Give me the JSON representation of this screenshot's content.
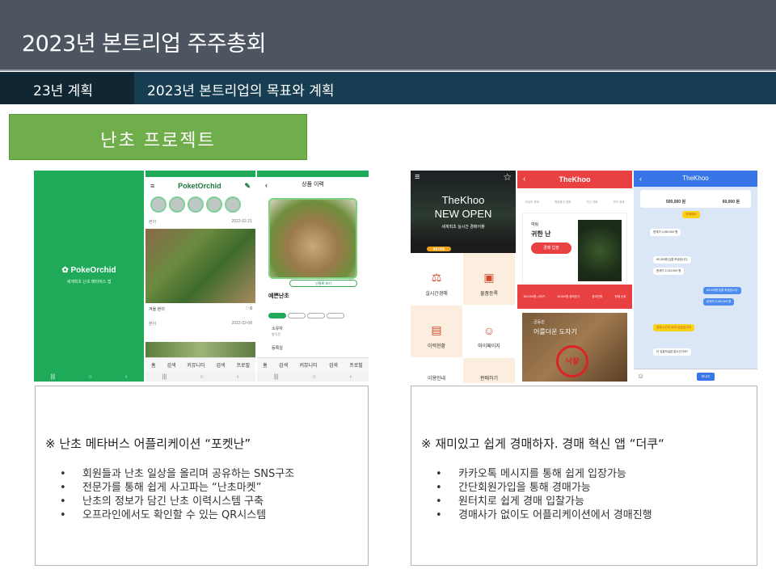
{
  "header": {
    "title": "2023년 본트리업 주주총회"
  },
  "subbar": {
    "left_label": "23년 계획",
    "right_label": "2023년 본트리업의 목표와 계획"
  },
  "project": {
    "title": "난초 프로젝트"
  },
  "phones": {
    "splash": {
      "logo": "PokeOrchid",
      "tagline": "세계최초 난초 메타버스 앱"
    },
    "feed": {
      "app_name": "PoketOrchid",
      "post1_user": "본이",
      "post1_date": "2022-02-21",
      "post1_caption": "겨울 본이",
      "post2_user": "본이",
      "post2_date": "2022-02-08",
      "tab_labels": [
        "홈",
        "검색",
        "커뮤니티",
        "검색",
        "프로필"
      ]
    },
    "product": {
      "title": "상품 이력",
      "pill": "난명록 보기",
      "name": "예쁜난초",
      "owner_label": "소유자",
      "owner_value": "왕익진",
      "register_label": "등록일",
      "tab_labels": [
        "홈",
        "검색",
        "커뮤니티",
        "검색",
        "프로필"
      ]
    },
    "thekhoo_main": {
      "headline_1": "TheKhoo",
      "headline_2": "NEW OPEN",
      "subline": "세계최초 실시간 경매어플",
      "badge": "경매 진행중",
      "tiles": [
        "실시간경매",
        "물품등록",
        "이력현황",
        "마이페이지",
        "이용안내",
        "판매하기"
      ]
    },
    "thekhoo_auction": {
      "title": "TheKhoo",
      "tabs": [
        "오늘의 경매",
        "예정중인 경매",
        "지난 경매",
        "마지 경매"
      ],
      "card_label": "예림",
      "card_title": "귀한 난",
      "card_button": "경매 입장",
      "stats": [
        "500,000원 시작가",
        "25,000원 경매호가",
        "참여인원",
        "현재 순위"
      ],
      "lower_label": "궁동원",
      "lower_title": "어를더운 도자기",
      "stamp": "낙찰"
    },
    "thekhoo_chat": {
      "title": "TheKhoo",
      "price_left": "500,000 원",
      "price_right": "60,000 원",
      "bubbles": [
        "경매종료!",
        "현재가 2,060,000 원",
        "60,000원 입찰 하였습니다.",
        "현재가 2,120,000 원",
        "60,000원 입찰 하였습니다.",
        "현재가 2,180,000 원",
        "경매 시간이 30초 남았습니다!",
        "더 입찰하실분 없으신가요?"
      ],
      "send": "보내기"
    }
  },
  "left_desc": {
    "heading": "※ 난초 메타버스 어플리케이션 “포켓난”",
    "items": [
      "회원들과 난초 일상을 올리며 공유하는 SNS구조",
      "전문가를 통해 쉽게 사고파는 “난초마켓”",
      "난초의 정보가 담긴 난초 이력시스템 구축",
      "오프라인에서도 확인할 수 있는 QR시스템"
    ]
  },
  "right_desc": {
    "heading": "※ 재미있고 쉽게 경매하자. 경매 혁신 앱 “더쿠“",
    "items": [
      "카카오톡 메시지를 통해 쉽게 입장가능",
      "간단회원가입을 통해 경매가능",
      "원터치로 쉽게 경매 입찰가능",
      "경매사가 없이도 어플리케이션에서 경매진행"
    ]
  }
}
